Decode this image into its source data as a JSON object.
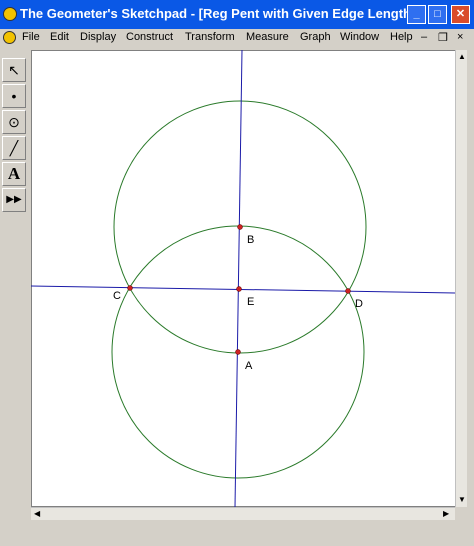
{
  "window": {
    "title": "The Geometer's Sketchpad - [Reg Pent with Given Edge Length]"
  },
  "titlebar_buttons": {
    "minimize": "_",
    "maximize": "□",
    "close": "✕"
  },
  "menu": [
    "File",
    "Edit",
    "Display",
    "Construct",
    "Transform",
    "Measure",
    "Graph",
    "Window",
    "Help"
  ],
  "mdi_buttons": {
    "minimize": "–",
    "restore": "❐",
    "close": "×"
  },
  "toolbox": [
    {
      "name": "arrow-tool",
      "glyph": "↖"
    },
    {
      "name": "point-tool",
      "glyph": "•"
    },
    {
      "name": "compass-tool",
      "glyph": "⊙"
    },
    {
      "name": "straightedge-tool",
      "glyph": "╱"
    },
    {
      "name": "text-tool",
      "glyph": "A"
    },
    {
      "name": "custom-tool",
      "glyph": "▶▶"
    }
  ],
  "points": {
    "A": "A",
    "B": "B",
    "C": "C",
    "D": "D",
    "E": "E"
  },
  "colors": {
    "circle": "#2a7a2a",
    "line": "#1a1aa8",
    "point": "#cc2222"
  },
  "scroll_arrows": {
    "up": "▲",
    "down": "▼",
    "left": "◀",
    "right": "▶"
  }
}
